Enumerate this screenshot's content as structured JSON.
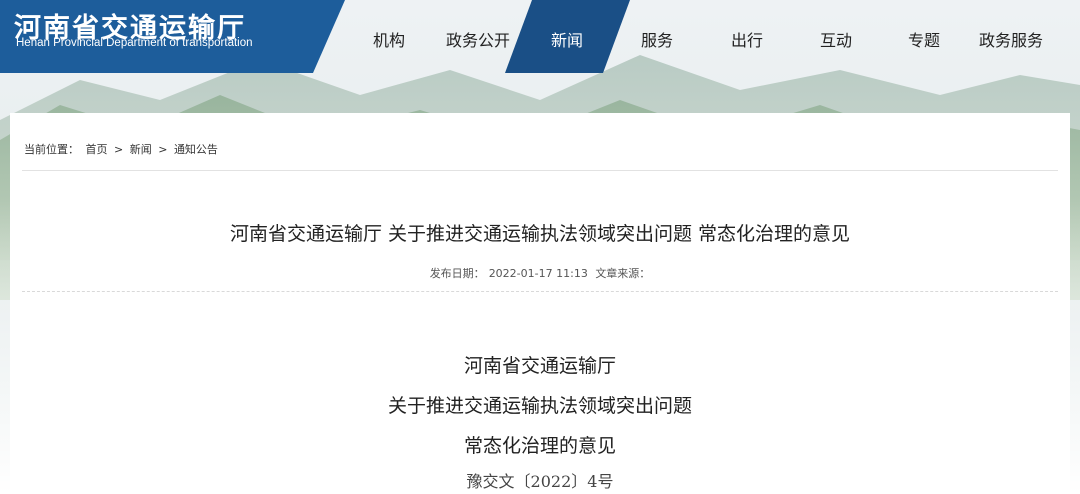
{
  "colors": {
    "brand_blue": "#1d5d9b",
    "nav_active": "#1a4f86"
  },
  "header": {
    "logo_title": "河南省交通运输厅",
    "logo_subtitle": "Henan Provincial Department of transportation"
  },
  "nav": {
    "items": [
      {
        "label": "机构",
        "active": false
      },
      {
        "label": "政务公开",
        "active": false
      },
      {
        "label": "新闻",
        "active": true
      },
      {
        "label": "服务",
        "active": false
      },
      {
        "label": "出行",
        "active": false
      },
      {
        "label": "互动",
        "active": false
      },
      {
        "label": "专题",
        "active": false
      },
      {
        "label": "政务服务",
        "active": false
      }
    ]
  },
  "breadcrumb": {
    "prefix": "当前位置：",
    "home": "首页",
    "sep": ">",
    "news": "新闻",
    "notice": "通知公告"
  },
  "article": {
    "title": "河南省交通运输厅 关于推进交通运输执法领域突出问题 常态化治理的意见",
    "publish_label": "发布日期：",
    "publish_date": "2022-01-17 11:13",
    "source_label": "文章来源：",
    "heading_line1": "河南省交通运输厅",
    "heading_line2": "关于推进交通运输执法领域突出问题",
    "heading_line3": "常态化治理的意见",
    "doc_number": "豫交文〔2022〕4号"
  }
}
